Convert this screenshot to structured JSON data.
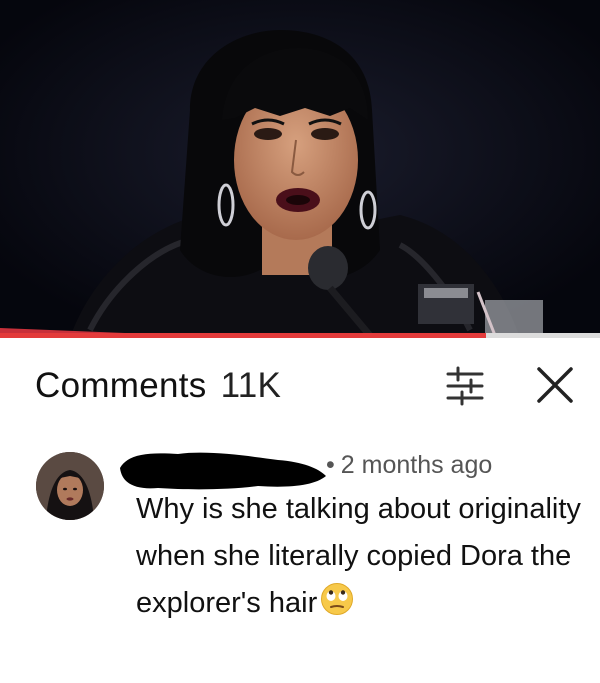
{
  "player": {
    "progress_fraction": 0.81,
    "accent_color": "#e33b3b",
    "background_color": "#05060d"
  },
  "comments_header": {
    "title": "Comments",
    "count": "11K",
    "filter_icon": "sort-icon",
    "close_icon": "close-icon"
  },
  "comment": {
    "avatar_icon": "avatar",
    "author_redacted": true,
    "timestamp": "2 months ago",
    "separator": "•",
    "text": "Why is she talking about originality when she literally copied Dora the explorer's hair",
    "emoji": "eye-roll-emoji"
  }
}
